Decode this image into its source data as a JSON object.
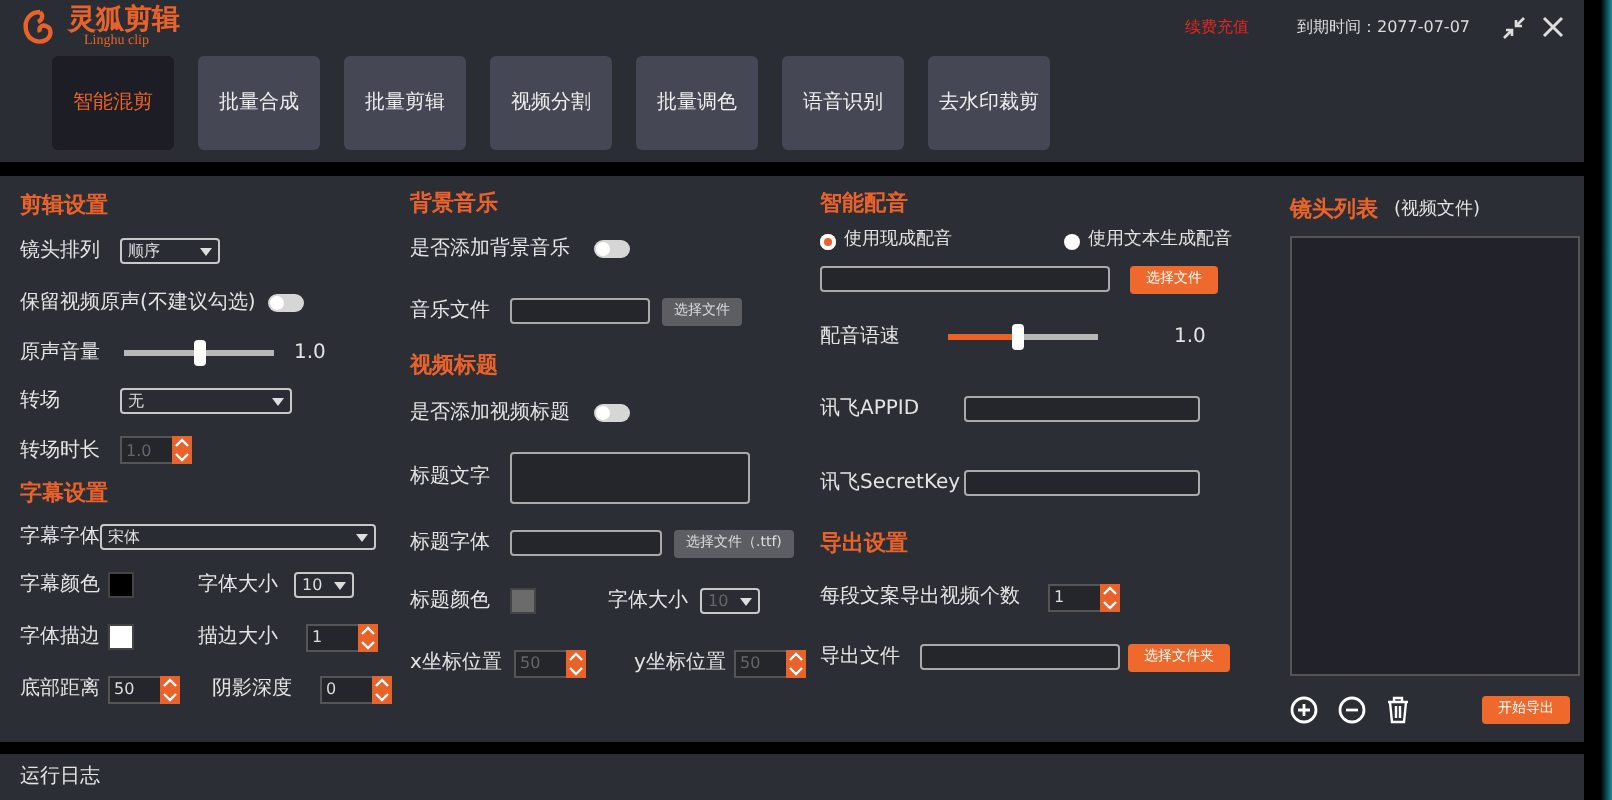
{
  "header": {
    "logo_title": "灵狐剪辑",
    "logo_subtitle": "Linghu clip",
    "notice": "续费充值",
    "expiry": "到期时间：2077-07-07"
  },
  "tabs": [
    {
      "label": "智能混剪",
      "selected": true
    },
    {
      "label": "批量合成",
      "selected": false
    },
    {
      "label": "批量剪辑",
      "selected": false
    },
    {
      "label": "视频分割",
      "selected": false
    },
    {
      "label": "批量调色",
      "selected": false
    },
    {
      "label": "语音识别",
      "selected": false
    },
    {
      "label": "去水印裁剪",
      "selected": false
    }
  ],
  "edit_settings": {
    "title": "剪辑设置",
    "shot_order": {
      "label": "镜头排列",
      "value": "顺序"
    },
    "keep_audio": {
      "label": "保留视频原声(不建议勾选)",
      "on": false
    },
    "volume": {
      "label": "原声音量",
      "level": 0.5,
      "filled": false,
      "reading": "1.0"
    },
    "transition": {
      "label": "转场",
      "value": "无"
    },
    "transition_duration": {
      "label": "转场时长",
      "value": "1.0",
      "disabled": true
    }
  },
  "subtitle_settings": {
    "title": "字幕设置",
    "font": {
      "label": "字幕字体",
      "value": "宋体"
    },
    "color": {
      "label": "字幕颜色",
      "color": "#000000"
    },
    "font_size": {
      "label": "字体大小",
      "value": "10"
    },
    "stroke": {
      "label": "字体描边",
      "color": "#ffffff"
    },
    "stroke_size": {
      "label": "描边大小",
      "value": "1"
    },
    "bottom_distance": {
      "label": "底部距离",
      "value": "50"
    },
    "shadow_depth": {
      "label": "阴影深度",
      "value": "0"
    }
  },
  "bg_music": {
    "title": "背景音乐",
    "enable": {
      "label": "是否添加背景音乐",
      "on": false
    },
    "file": {
      "label": "音乐文件",
      "button": "选择文件"
    }
  },
  "video_title": {
    "title": "视频标题",
    "enable": {
      "label": "是否添加视频标题",
      "on": false
    },
    "text": {
      "label": "标题文字"
    },
    "font": {
      "label": "标题字体",
      "button": "选择文件（.ttf)"
    },
    "color": {
      "label": "标题颜色",
      "color": "#6b6b6b"
    },
    "font_size": {
      "label": "字体大小",
      "value": "10",
      "disabled": true
    },
    "x": {
      "label": "x坐标位置",
      "value": "50",
      "disabled": true
    },
    "y": {
      "label": "y坐标位置",
      "value": "50",
      "disabled": true
    }
  },
  "dubbing": {
    "title": "智能配音",
    "modes": [
      {
        "label": "使用现成配音",
        "selected": true
      },
      {
        "label": "使用文本生成配音",
        "selected": false
      }
    ],
    "file_button": "选择文件",
    "speed": {
      "label": "配音语速",
      "level": 0.47,
      "filled": true,
      "reading": "1.0"
    },
    "appid": {
      "label": "讯飞APPID"
    },
    "secret": {
      "label": "讯飞SecretKey"
    }
  },
  "export": {
    "title": "导出设置",
    "count": {
      "label": "每段文案导出视频个数",
      "value": "1"
    },
    "folder": {
      "label": "导出文件",
      "button": "选择文件夹"
    }
  },
  "shot_list": {
    "title": "镜头列表",
    "subtitle": "(视频文件)",
    "start_button": "开始导出"
  },
  "log": {
    "title": "运行日志"
  }
}
